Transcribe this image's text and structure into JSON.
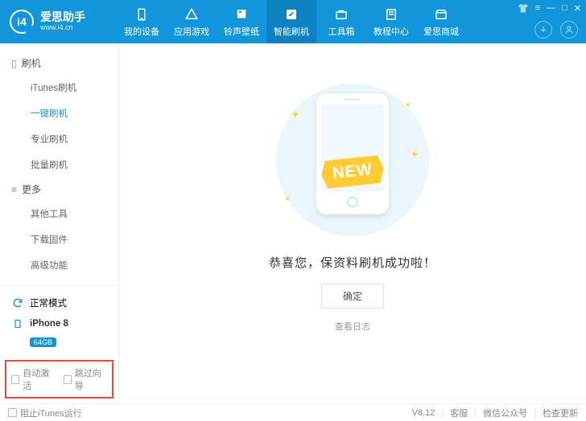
{
  "app": {
    "name": "爱思助手",
    "url": "www.i4.cn",
    "logo_text": "i4"
  },
  "nav": [
    {
      "label": "我的设备",
      "icon": "device"
    },
    {
      "label": "应用游戏",
      "icon": "apps"
    },
    {
      "label": "铃声壁纸",
      "icon": "music"
    },
    {
      "label": "智能刷机",
      "icon": "flash",
      "active": true
    },
    {
      "label": "工具箱",
      "icon": "toolbox"
    },
    {
      "label": "教程中心",
      "icon": "tutorial"
    },
    {
      "label": "爱思商城",
      "icon": "store"
    }
  ],
  "sidebar": {
    "group1": {
      "title": "刷机",
      "items": [
        "iTunes刷机",
        "一键刷机",
        "专业刷机",
        "批量刷机"
      ],
      "active_index": 1
    },
    "group2": {
      "title": "更多",
      "items": [
        "其他工具",
        "下载固件",
        "高级功能"
      ]
    },
    "mode_label": "正常模式",
    "device_name": "iPhone 8",
    "device_badge": "64GB",
    "options": {
      "auto_activate": "自动激活",
      "skip_guide": "跳过向导"
    }
  },
  "main": {
    "ribbon": "NEW",
    "success": "恭喜您，保资料刷机成功啦！",
    "ok": "确定",
    "view_log": "查看日志"
  },
  "footer": {
    "block_itunes": "阻止iTunes运行",
    "version": "V8.12",
    "support": "客服",
    "wechat": "微信公众号",
    "update": "检查更新"
  }
}
